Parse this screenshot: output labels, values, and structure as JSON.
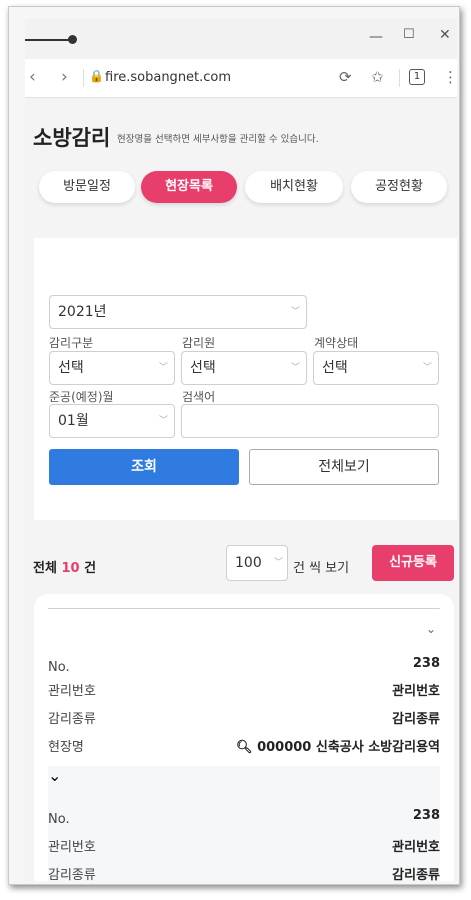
{
  "browser": {
    "url": "fire.sobangnet.com",
    "tab_count": "1"
  },
  "page": {
    "title": "소방감리",
    "subtitle": "현장명을 선택하면 세부사항을 관리할 수 있습니다.",
    "tabs": [
      {
        "label": "방문일정",
        "active": false
      },
      {
        "label": "현장목록",
        "active": true
      },
      {
        "label": "배치현황",
        "active": false
      },
      {
        "label": "공정현황",
        "active": false
      }
    ]
  },
  "filter": {
    "year": "2021년",
    "supervision_type": {
      "label": "감리구분",
      "value": "선택"
    },
    "supervisor": {
      "label": "감리원",
      "value": "선택"
    },
    "contract_status": {
      "label": "계약상태",
      "value": "선택"
    },
    "completion_month": {
      "label": "준공(예정)월",
      "value": "01월"
    },
    "search": {
      "label": "검색어",
      "value": ""
    },
    "search_button": "조회",
    "view_all_button": "전체보기"
  },
  "summary": {
    "prefix": "전체",
    "count": "10",
    "suffix": "건",
    "per_page": "100",
    "per_page_label": "건 씩 보기",
    "new_button": "신규등록"
  },
  "records": [
    {
      "no_label": "No.",
      "no": "238",
      "mgmt_label": "관리번호",
      "mgmt": "관리번호",
      "kind_label": "감리종류",
      "kind": "감리종류",
      "site_label": "현장명",
      "site": "000000 신축공사 소방감리용역"
    },
    {
      "no_label": "No.",
      "no": "238",
      "mgmt_label": "관리번호",
      "mgmt": "관리번호",
      "kind_label": "감리종류",
      "kind": "감리종류"
    }
  ]
}
